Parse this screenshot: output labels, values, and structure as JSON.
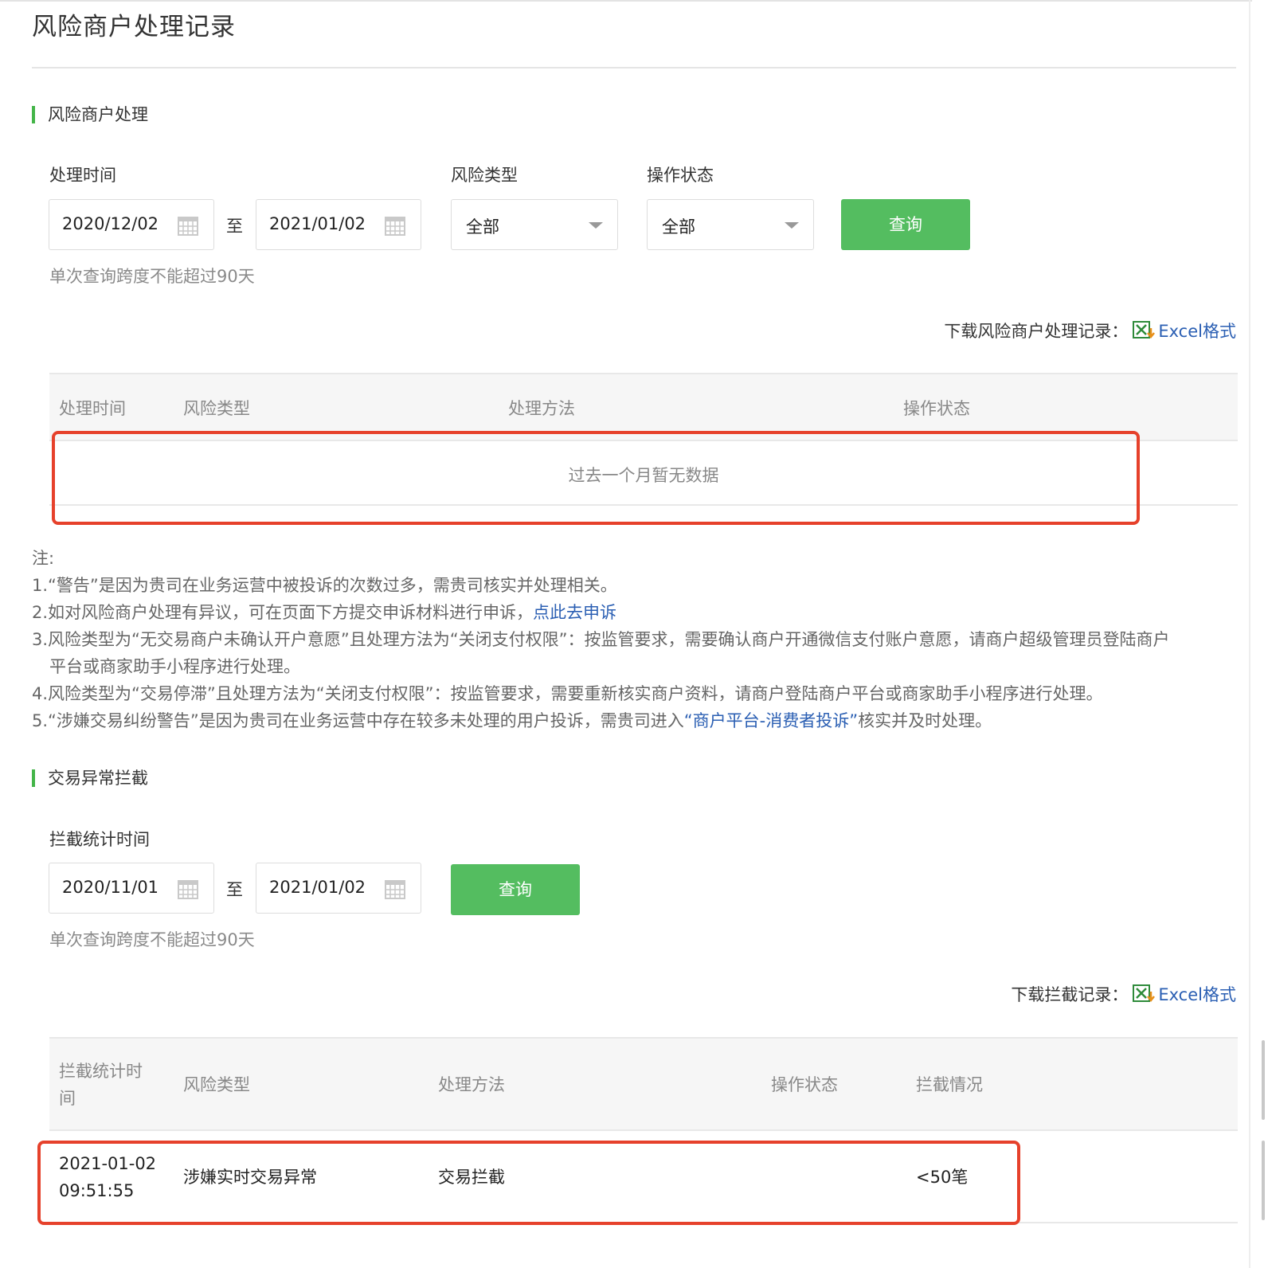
{
  "page": {
    "title": "风险商户处理记录"
  },
  "risk_section": {
    "title": "风险商户处理",
    "labels": {
      "time": "处理时间",
      "type": "风险类型",
      "status": "操作状态"
    },
    "date_from": "2020/12/02",
    "to": "至",
    "date_to": "2021/01/02",
    "type_select": "全部",
    "status_select": "全部",
    "query": "查询",
    "hint": "单次查询跨度不能超过90天",
    "download_label": "下载风险商户处理记录：",
    "download_link": "Excel格式",
    "table": {
      "headers": [
        "处理时间",
        "风险类型",
        "处理方法",
        "操作状态"
      ],
      "empty": "过去一个月暂无数据"
    }
  },
  "notes": {
    "title": "注:",
    "n1": "1.“警告”是因为贵司在业务运营中被投诉的次数过多，需贵司核实并处理相关。",
    "n2_text": "2.如对风险商户处理有异议，可在页面下方提交申诉材料进行申诉，",
    "n2_link": "点此去申诉",
    "n3_line1": "3.风险类型为“无交易商户未确认开户意愿”且处理方法为“关闭支付权限”：按监管要求，需要确认商户开通微信支付账户意愿，请商户超级管理员登陆商户",
    "n3_line2": "平台或商家助手小程序进行处理。",
    "n4": "4.风险类型为“交易停滞”且处理方法为“关闭支付权限”：按监管要求，需要重新核实商户资料，请商户登陆商户平台或商家助手小程序进行处理。",
    "n5_a": "5.“涉嫌交易纠纷警告”是因为贵司在业务运营中存在较多未处理的用户投诉，需贵司进入",
    "n5_link": "“商户平台-消费者投诉”",
    "n5_b": "核实并及时处理。"
  },
  "intercept_section": {
    "title": "交易异常拦截",
    "label": "拦截统计时间",
    "date_from": "2020/11/01",
    "to": "至",
    "date_to": "2021/01/02",
    "query": "查询",
    "hint": "单次查询跨度不能超过90天",
    "download_label": "下载拦截记录：",
    "download_link": "Excel格式",
    "table": {
      "headers": {
        "time_l1": "拦截统计时",
        "time_l2": "间",
        "type": "风险类型",
        "method": "处理方法",
        "status": "操作状态",
        "result": "拦截情况"
      },
      "rows": [
        {
          "date": "2021-01-02",
          "time": "09:51:55",
          "type": "涉嫌实时交易异常",
          "method": "交易拦截",
          "status": "",
          "result": "<50笔"
        }
      ]
    }
  },
  "colors": {
    "accent_green": "#54bd60",
    "link_blue": "#2b5fb3",
    "highlight_red": "#e6412b"
  }
}
